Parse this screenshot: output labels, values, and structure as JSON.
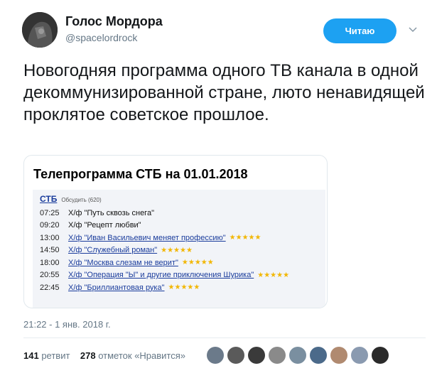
{
  "header": {
    "display_name": "Голос Мордора",
    "handle": "@spacelordrock",
    "follow_button_label": "Читаю"
  },
  "tweet": {
    "text": "Новогодняя программа одного ТВ канала в одной декоммунизированной стране, люто ненавидящей проклятое советское прошлое."
  },
  "card": {
    "title": "Телепрограмма СТБ на 01.01.2018",
    "channel": "СТБ",
    "discuss": "Обсудить (620)",
    "schedule": [
      {
        "time": "07:25",
        "show": "Х/ф \"Путь сквозь снега\"",
        "link": false,
        "stars": ""
      },
      {
        "time": "09:20",
        "show": "Х/ф \"Рецепт любви\"",
        "link": false,
        "stars": ""
      },
      {
        "time": "13:00",
        "show": "Х/ф \"Иван Васильевич меняет профессию\"",
        "link": true,
        "stars": "★★★★★"
      },
      {
        "time": "14:50",
        "show": "Х/ф \"Служебный роман\"",
        "link": true,
        "stars": "★★★★★"
      },
      {
        "time": "18:00",
        "show": "Х/ф \"Москва слезам не верит\"",
        "link": true,
        "stars": "★★★★★"
      },
      {
        "time": "20:55",
        "show": "Х/ф \"Операция \"Ы\" и другие приключения Шурика\"",
        "link": true,
        "stars": "★★★★★"
      },
      {
        "time": "22:45",
        "show": "Х/ф \"Бриллиантовая рука\"",
        "link": true,
        "stars": "★★★★★"
      }
    ]
  },
  "footer": {
    "timestamp": "21:22 - 1 янв. 2018 г.",
    "retweets_count": "141",
    "retweets_label": "ретвит",
    "likes_count": "278",
    "likes_label": "отметок «Нравится»",
    "likers": [
      "#6b7a8a",
      "#5a5a5a",
      "#3a3a3a",
      "#8a8a8a",
      "#7a8fa0",
      "#4b6a8a",
      "#b08a70",
      "#8a9ab0",
      "#2a2a2a"
    ]
  },
  "icons": {
    "menu": "chevron-down-icon"
  }
}
